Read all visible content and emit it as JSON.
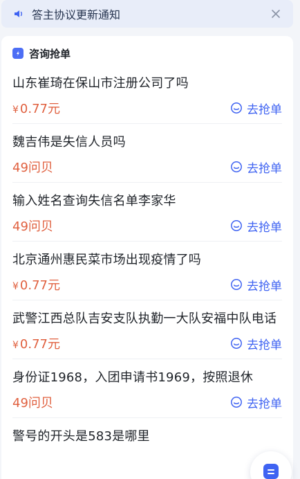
{
  "notice": {
    "text": "答主协议更新通知",
    "icon": "speaker-icon",
    "close_icon": "close-icon"
  },
  "section": {
    "title": "咨询抢单",
    "icon": "consult-badge-icon"
  },
  "grab_label": "去抢单",
  "items": [
    {
      "question": "山东崔琦在保山市注册公司了吗",
      "currency": "¥",
      "price": "0.77元"
    },
    {
      "question": "魏吉伟是失信人员吗",
      "currency": "",
      "price": "49问贝"
    },
    {
      "question": "输入姓名查询失信名单李家华",
      "currency": "",
      "price": "49问贝"
    },
    {
      "question": "北京通州惠民菜市场出现疫情了吗",
      "currency": "¥",
      "price": "0.77元"
    },
    {
      "question": "武警江西总队吉安支队执勤一大队安福中队电话",
      "currency": "¥",
      "price": "0.77元"
    },
    {
      "question": "身份证1968，入团申请书1969，按照退休",
      "currency": "",
      "price": "49问贝"
    },
    {
      "question": "警号的开头是583是哪里",
      "currency": "",
      "price": ""
    }
  ],
  "colors": {
    "accent": "#3f63f2",
    "price": "#e0603f",
    "notice_bg": "#e8edf9",
    "page_bg": "#f3f5f9"
  }
}
